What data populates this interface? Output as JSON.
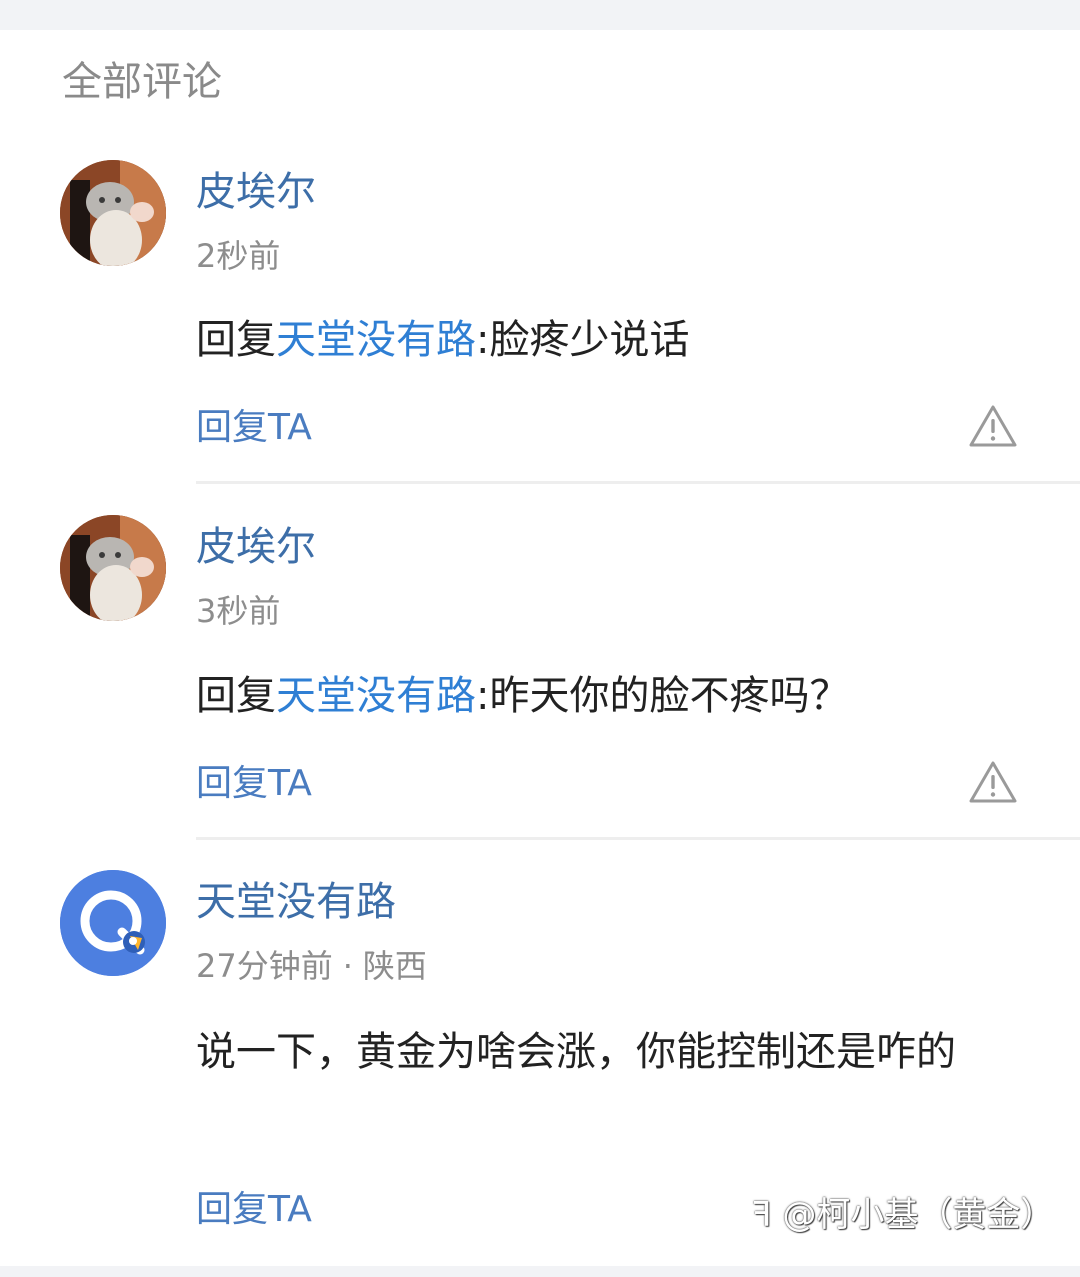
{
  "section": {
    "title": "全部评论"
  },
  "comments": [
    {
      "username": "皮埃尔",
      "time": "2秒前",
      "location": "",
      "reply_prefix": "回复",
      "mention": "天堂没有路",
      "text": ":脸疼少说话",
      "reply_label": "回复TA",
      "avatar": "cat-photo-avatar",
      "report_icon": "warning-triangle-icon"
    },
    {
      "username": "皮埃尔",
      "time": "3秒前",
      "location": "",
      "reply_prefix": "回复",
      "mention": "天堂没有路",
      "text": ":昨天你的脸不疼吗？",
      "reply_label": "回复TA",
      "avatar": "cat-photo-avatar",
      "report_icon": "warning-triangle-icon"
    },
    {
      "username": "天堂没有路",
      "time": "27分钟前",
      "separator": "·",
      "location": "陕西",
      "text": "说一下，黄金为啥会涨，你能控制还是咋的",
      "reply_label": "回复TA",
      "avatar": "rocket-app-avatar"
    }
  ],
  "watermark": "@柯小基（黄金）",
  "colors": {
    "username": "#3d6ea8",
    "mention": "#2f7fd4",
    "reply": "#4a7cc0",
    "meta": "#8d8d8d",
    "body_text": "#222222"
  }
}
